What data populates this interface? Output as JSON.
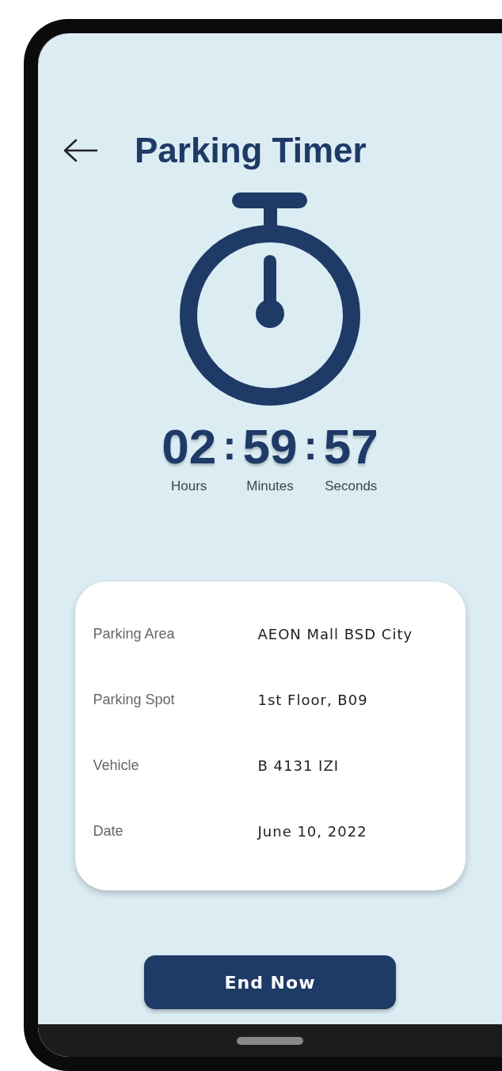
{
  "header": {
    "title": "Parking Timer"
  },
  "timer": {
    "units": [
      {
        "value": "02",
        "label": "Hours"
      },
      {
        "value": "59",
        "label": "Minutes"
      },
      {
        "value": "57",
        "label": "Seconds"
      }
    ],
    "separators": [
      ":",
      ":"
    ]
  },
  "details": [
    {
      "label": "Parking Area",
      "value": "AEON Mall BSD City"
    },
    {
      "label": "Parking Spot",
      "value": "1st Floor, B09"
    },
    {
      "label": "Vehicle",
      "value": "B 4131 IZI"
    },
    {
      "label": "Date",
      "value": "June 10, 2022"
    }
  ],
  "end_button": {
    "label": "End Now"
  }
}
